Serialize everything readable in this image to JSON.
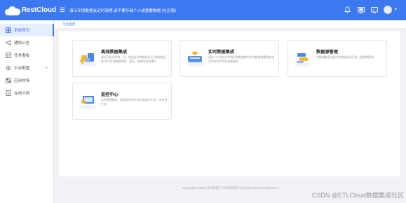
{
  "header": {
    "logo_text": "RestCloud",
    "banner": "演示环境数据会定时清理,请不要存储个人或重要数据 (社区版)",
    "icons": [
      "bell-icon",
      "screen-icon",
      "tv-icon",
      "avatar",
      "chevron-down-icon"
    ],
    "accent_color": "#3c78f0"
  },
  "sidebar": {
    "items": [
      {
        "label": "系统首页",
        "icon": "home-icon",
        "active": true
      },
      {
        "label": "通知公告",
        "icon": "megaphone-icon"
      },
      {
        "label": "任务看板",
        "icon": "dashboard-icon"
      },
      {
        "label": "平台配置",
        "icon": "settings-icon",
        "expandable": true
      },
      {
        "label": "应用市场",
        "icon": "grid-icon"
      },
      {
        "label": "在线文档",
        "icon": "document-icon"
      }
    ]
  },
  "breadcrumb": "平台首页",
  "cards": [
    {
      "title": "离线数据集成",
      "desc": "通过可视化的拖、拉、拽连接异构数据源之间的数据迁移,并可实现数据转换、清洗、增量等各种操作",
      "icon": "etl-illustration"
    },
    {
      "title": "实时数据集成",
      "desc": "通过CDC等技术实时获取数据库的实时数据增删改变化并实时同步到目标数据库",
      "icon": "realtime-illustration"
    },
    {
      "title": "数据源管理",
      "desc": "对数据集成过程中的数据源进行统一配置和管理",
      "icon": "datasource-illustration"
    },
    {
      "title": "监控中心",
      "desc": "实时数据集成、离线同步的任务状态监控在线,一览所有任务",
      "icon": "monitor-illustration"
    }
  ],
  "footer": "Copyright © 2024    谷云科技(广州)有限责任公司    https://www.restcloud.cn",
  "watermark": "CSDN @ETLCloud数据集成社区"
}
